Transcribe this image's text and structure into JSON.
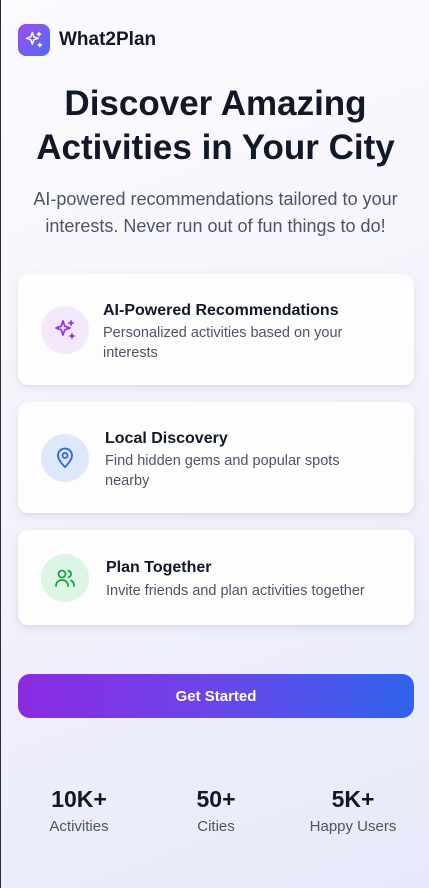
{
  "app": {
    "name": "What2Plan",
    "logo_icon": "sparkles-icon"
  },
  "hero": {
    "title": "Discover Amazing Activities in Your City",
    "subtitle": "AI-powered recommendations tailored to your interests. Never run out of fun things to do!"
  },
  "features": [
    {
      "title": "AI-Powered Recommendations",
      "description": "Personalized activities based on your interests",
      "icon": "sparkles-icon",
      "color": "#9333ea",
      "bg": "#f3e8fc"
    },
    {
      "title": "Local Discovery",
      "description": "Find hidden gems and popular spots nearby",
      "icon": "map-pin-icon",
      "color": "#2563eb",
      "bg": "#dde8fb"
    },
    {
      "title": "Plan Together",
      "description": "Invite friends and plan activities together",
      "icon": "users-icon",
      "color": "#16a34a",
      "bg": "#dcf5e4"
    }
  ],
  "cta": {
    "label": "Get Started"
  },
  "stats": [
    {
      "value": "10K+",
      "label": "Activities"
    },
    {
      "value": "50+",
      "label": "Cities"
    },
    {
      "value": "5K+",
      "label": "Happy Users"
    }
  ],
  "colors": {
    "accent_start": "#8b2be2",
    "accent_end": "#2f63ec",
    "text": "#111827",
    "muted": "#4b5563"
  }
}
